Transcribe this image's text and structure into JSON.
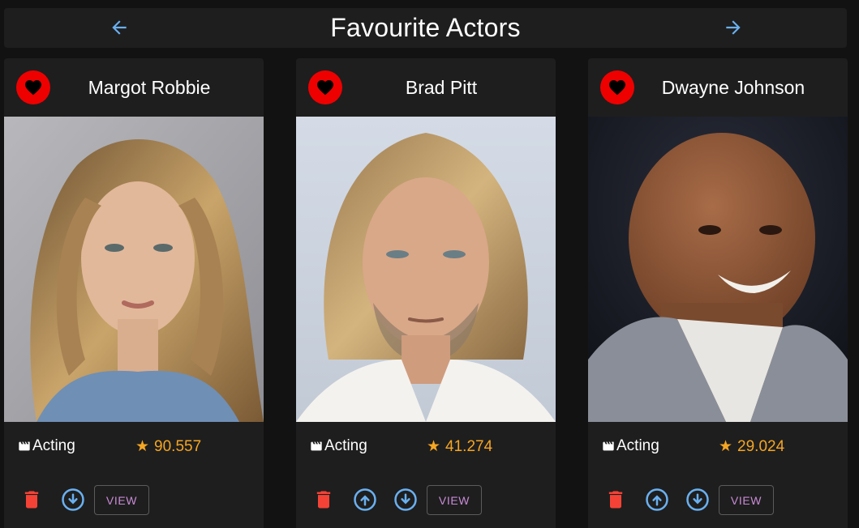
{
  "header": {
    "title": "Favourite Actors",
    "prev_icon": "arrow-left-icon",
    "next_icon": "arrow-right-icon"
  },
  "colors": {
    "accent_blue": "#6ab0f0",
    "favorite_red": "#ee0000",
    "delete_red": "#f44336",
    "rating_orange": "#f5a623",
    "view_purple": "#c98bd6"
  },
  "actors": [
    {
      "name": "Margot Robbie",
      "department": "Acting",
      "popularity": "90.557",
      "view_label": "VIEW",
      "actions": [
        "delete-icon",
        "move-down-icon"
      ]
    },
    {
      "name": "Brad Pitt",
      "department": "Acting",
      "popularity": "41.274",
      "view_label": "VIEW",
      "actions": [
        "delete-icon",
        "move-up-icon",
        "move-down-icon"
      ]
    },
    {
      "name": "Dwayne Johnson",
      "department": "Acting",
      "popularity": "29.024",
      "view_label": "VIEW",
      "actions": [
        "delete-icon",
        "move-up-icon",
        "move-down-icon"
      ]
    }
  ]
}
